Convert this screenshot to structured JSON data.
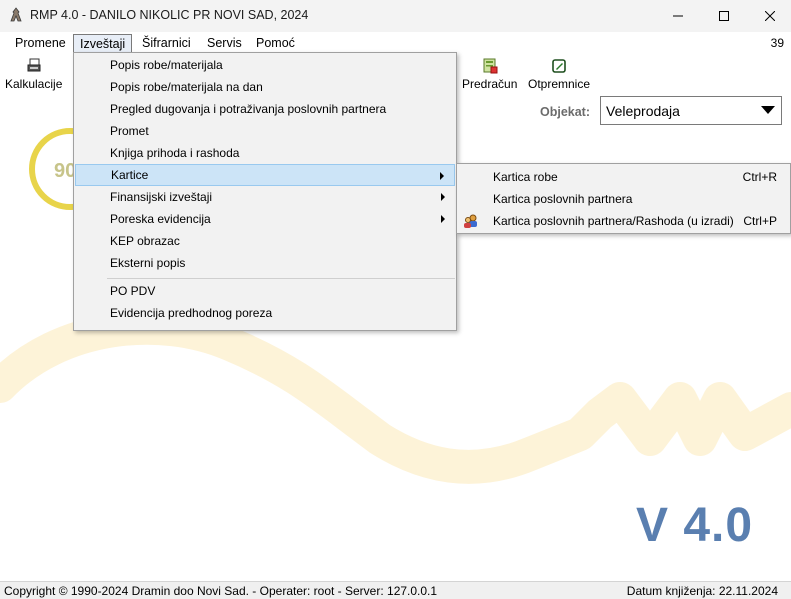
{
  "window": {
    "title": "RMP 4.0 - DANILO NIKOLIC PR NOVI SAD, 2024",
    "controls": {
      "minimize": "minimize-icon",
      "maximize": "maximize-icon",
      "close": "close-icon"
    }
  },
  "menubar": {
    "items": [
      {
        "label": "Promene"
      },
      {
        "label": "Izveštaji"
      },
      {
        "label": "Šifrarnici"
      },
      {
        "label": "Servis"
      },
      {
        "label": "Pomoć"
      }
    ],
    "count": "39"
  },
  "toolbar": {
    "items": [
      {
        "label": "Kalkulacije",
        "icon": "kalkulacije-icon"
      },
      {
        "label": "Predračun",
        "icon": "predracun-icon"
      },
      {
        "label": "Otpremnice",
        "icon": "otpremnice-icon"
      }
    ]
  },
  "objekat": {
    "label": "Objekat:",
    "value": "Veleprodaja"
  },
  "dropdown": {
    "items": [
      {
        "label": "Popis robe/materijala"
      },
      {
        "label": "Popis robe/materijala na dan"
      },
      {
        "label": "Pregled dugovanja i potraživanja poslovnih partnera"
      },
      {
        "label": "Promet"
      },
      {
        "label": "Knjiga prihoda i rashoda"
      },
      {
        "label": "Kartice"
      },
      {
        "label": "Finansijski izveštaji"
      },
      {
        "label": "Poreska evidencija"
      },
      {
        "label": "KEP obrazac"
      },
      {
        "label": "Eksterni popis"
      },
      {
        "label": "PO PDV"
      },
      {
        "label": "Evidencija predhodnog poreza"
      }
    ]
  },
  "submenu": {
    "items": [
      {
        "label": "Kartica robe",
        "shortcut": "Ctrl+R"
      },
      {
        "label": "Kartica poslovnih partnera",
        "shortcut": ""
      },
      {
        "label": "Kartica poslovnih partnera/Rashoda (u izradi)",
        "shortcut": "Ctrl+P"
      }
    ]
  },
  "logo": {
    "partial_text": "90"
  },
  "version": "V 4.0",
  "statusbar": {
    "left": "Copyright © 1990-2024 Dramin doo Novi Sad. - Operater: root - Server: 127.0.0.1",
    "right": "Datum knjiženja: 22.11.2024"
  },
  "colors": {
    "accent": "#5a7fb0",
    "highlight": "#cce4f7",
    "watermark": "#fdf3d8",
    "logo_ring": "#e8d44a"
  }
}
